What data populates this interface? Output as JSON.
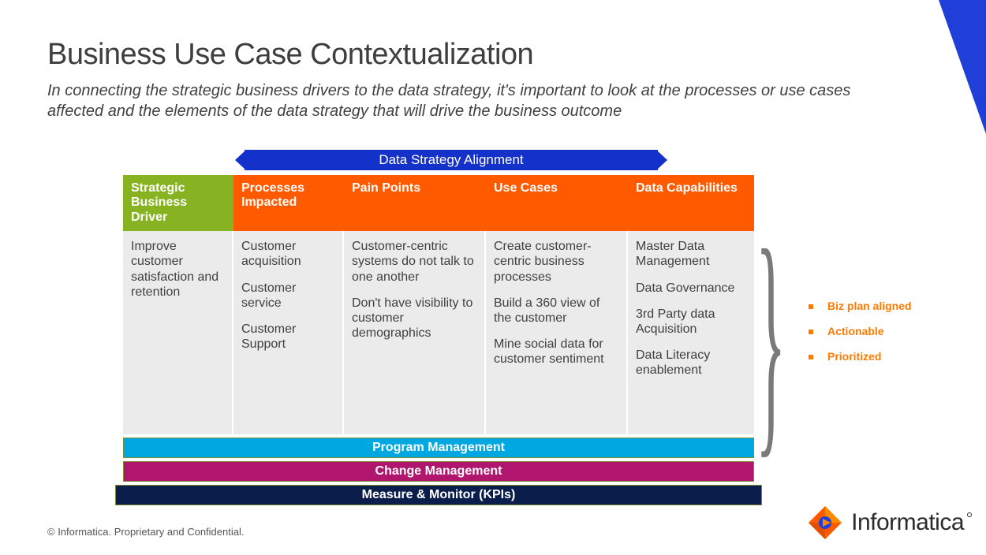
{
  "title": "Business Use Case Contextualization",
  "subtitle": "In connecting the strategic business drivers to the data strategy, it's important to look at the processes or use cases affected and the elements of the data strategy that will drive the business outcome",
  "dsa_label": "Data Strategy Alignment",
  "headers": {
    "driver": "Strategic Business Driver",
    "processes": "Processes Impacted",
    "pain": "Pain Points",
    "usecases": "Use Cases",
    "caps": "Data Capabilities"
  },
  "cells": {
    "driver": [
      "Improve customer satisfaction and retention"
    ],
    "processes": [
      "Customer acquisition",
      "Customer service",
      "Customer Support"
    ],
    "pain": [
      "Customer-centric systems do not talk to one another",
      "Don't have visibility to customer demographics"
    ],
    "usecases": [
      "Create customer-centric business processes",
      "Build a 360 view of the customer",
      "Mine social data for customer sentiment"
    ],
    "caps": [
      "Master Data Management",
      "Data Governance",
      "3rd Party data Acquisition",
      "Data Literacy enablement"
    ]
  },
  "footers": {
    "pm": "Program Management",
    "cm": "Change Management",
    "mm": "Measure & Monitor (KPIs)"
  },
  "bullets": [
    "Biz plan aligned",
    "Actionable",
    "Prioritized"
  ],
  "copyright": "© Informatica. Proprietary and Confidential.",
  "brand": "Informatica"
}
